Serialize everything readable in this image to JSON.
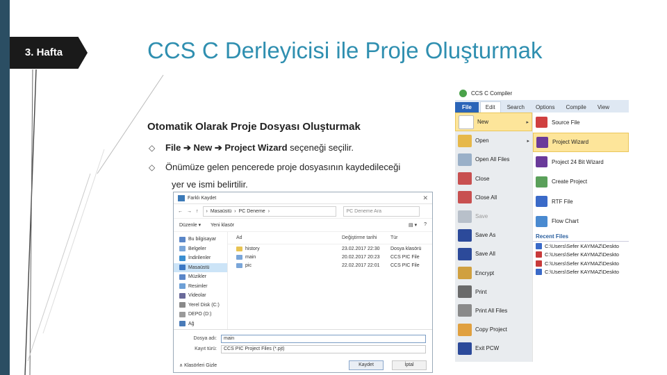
{
  "slide": {
    "week_tag": "3. Hafta",
    "title": "CCS C Derleyicisi ile Proje Oluşturmak",
    "subtitle": "Otomatik Olarak Proje Dosyası Oluşturmak",
    "bullet1_path": "File ➔ New ➔ Project Wizard",
    "bullet1_rest": " seçeneği seçilir.",
    "bullet2": "Önümüze gelen pencerede proje dosyasının kaydedileceği",
    "bullet2_cont": "yer ve ismi belirtilir.",
    "bullet_marker": "◇"
  },
  "save_dialog": {
    "title": "Farklı Kaydet",
    "close": "✕",
    "path_parts": [
      "Masaüstü",
      "PC Deneme"
    ],
    "path_sep": "›",
    "search_placeholder": "PC Deneme Ara",
    "organize": "Düzenle ▾",
    "new_folder": "Yeni klasör",
    "view_icon": "▤ ▾",
    "help_icon": "?",
    "nav_items": [
      {
        "label": "Bu bilgisayar",
        "color": "#5a86c8"
      },
      {
        "label": "Belgeler",
        "color": "#7aa6d9"
      },
      {
        "label": "İndirilenler",
        "color": "#3b8fd1"
      },
      {
        "label": "Masaüstü",
        "color": "#3b78c4"
      },
      {
        "label": "Müzikler",
        "color": "#5a86c8"
      },
      {
        "label": "Resimler",
        "color": "#6ea0d6"
      },
      {
        "label": "Videolar",
        "color": "#6a6a9a"
      },
      {
        "label": "Yerel Disk (C:)",
        "color": "#8a8a8a"
      },
      {
        "label": "DEPO (D:)",
        "color": "#9a9a9a"
      },
      {
        "label": "Ağ",
        "color": "#4a7bb8"
      }
    ],
    "columns": [
      "Ad",
      "Değiştirme tarihi",
      "Tür"
    ],
    "files": [
      {
        "name": "history",
        "date": "23.02.2017 22:30",
        "type": "Dosya klasörü",
        "kind": "folder"
      },
      {
        "name": "main",
        "date": "20.02.2017 20:23",
        "type": "CCS PIC File",
        "kind": "doc"
      },
      {
        "name": "pic",
        "date": "22.02.2017 22:01",
        "type": "CCS PIC File",
        "kind": "doc"
      }
    ],
    "filename_label": "Dosya adı:",
    "filename_value": "main",
    "filetype_label": "Kayıt türü:",
    "filetype_value": "CCS PIC Project Files (*.pjt)",
    "hide_folders": "∧ Klasörleri Gizle",
    "save_button": "Kaydet",
    "cancel_button": "İptal"
  },
  "ccs": {
    "title": "CCS C Compiler",
    "menu": [
      "File",
      "Edit",
      "Search",
      "Options",
      "Compile",
      "View"
    ],
    "left_items": [
      {
        "label": "New",
        "color": "#ffffff"
      },
      {
        "label": "Open",
        "color": "#e6b84a"
      },
      {
        "label": "Open All Files",
        "color": "#9ab0c8"
      },
      {
        "label": "Close",
        "color": "#c85050"
      },
      {
        "label": "Close All",
        "color": "#c85050"
      },
      {
        "label": "Save",
        "color": "#b8c0ca"
      },
      {
        "label": "Save As",
        "color": "#2c4a9a"
      },
      {
        "label": "Save All",
        "color": "#2c4a9a"
      },
      {
        "label": "Encrypt",
        "color": "#d0a040"
      },
      {
        "label": "Print",
        "color": "#6a6a6a"
      },
      {
        "label": "Print All Files",
        "color": "#8a8a8a"
      },
      {
        "label": "Copy Project",
        "color": "#e0a040"
      },
      {
        "label": "Exit PCW",
        "color": "#2c4a9a"
      }
    ],
    "new_arrow": "▸",
    "right_items": [
      {
        "label": "Source File",
        "color": "#d04040"
      },
      {
        "label": "Project Wizard",
        "color": "#6a3a9a"
      },
      {
        "label": "Project 24 Bit Wizard",
        "color": "#6a3a9a"
      },
      {
        "label": "Create Project",
        "color": "#5aa05a"
      },
      {
        "label": "RTF File",
        "color": "#3a6ac8"
      },
      {
        "label": "Flow Chart",
        "color": "#4a8ad0"
      }
    ],
    "recent_label": "Recent Files",
    "recent_files": [
      {
        "path": "C:\\Users\\Sefer KAYMAZ\\Deskto",
        "color": "#3a6ac8"
      },
      {
        "path": "C:\\Users\\Sefer KAYMAZ\\Deskto",
        "color": "#c83a3a"
      },
      {
        "path": "C:\\Users\\Sefer KAYMAZ\\Deskto",
        "color": "#c83a3a"
      },
      {
        "path": "C:\\Users\\Sefer KAYMAZ\\Deskto",
        "color": "#3a6ac8"
      }
    ]
  }
}
